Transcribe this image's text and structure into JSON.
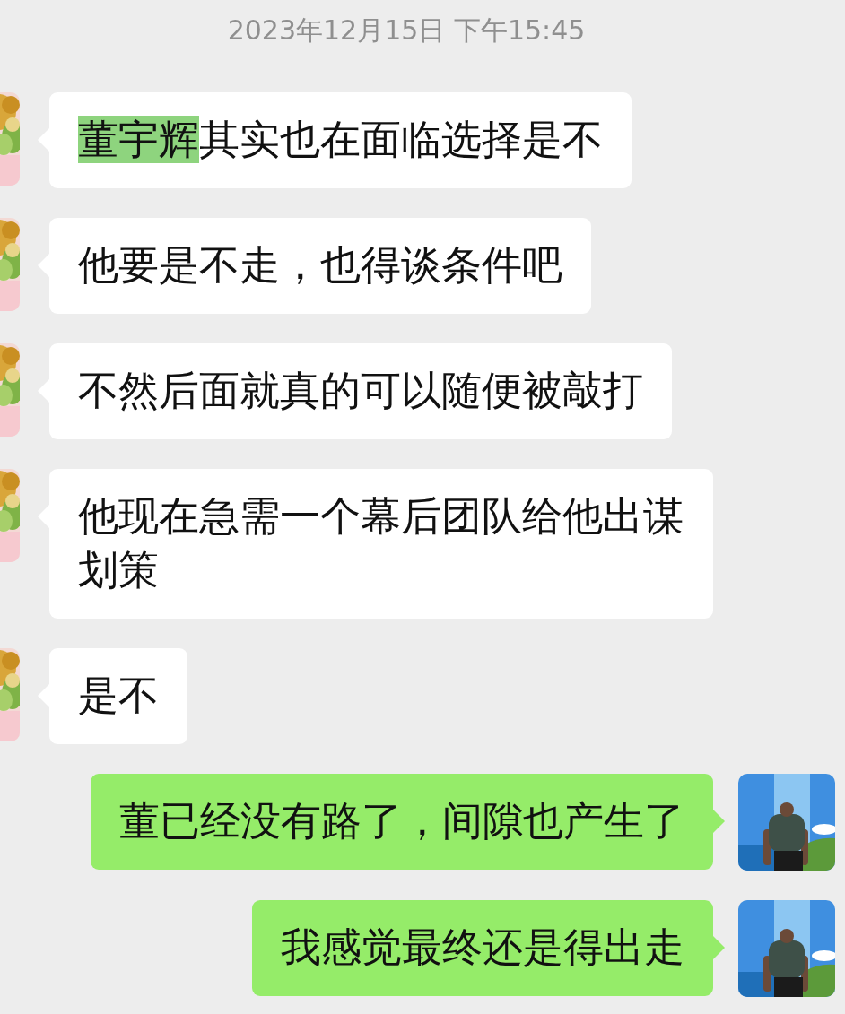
{
  "timestamp": "2023年12月15日 下午15:45",
  "messages": [
    {
      "kind": "incoming",
      "segments": [
        {
          "text": "董宇辉",
          "highlighted": true
        },
        {
          "text": "其实也在面临选择是不",
          "highlighted": false
        }
      ]
    },
    {
      "kind": "incoming",
      "segments": [
        {
          "text": "他要是不走，也得谈条件吧",
          "highlighted": false
        }
      ]
    },
    {
      "kind": "incoming",
      "segments": [
        {
          "text": "不然后面就真的可以随便被敲打",
          "highlighted": false
        }
      ]
    },
    {
      "kind": "incoming",
      "segments": [
        {
          "text": "他现在急需一个幕后团队给他出谋划策",
          "highlighted": false
        }
      ]
    },
    {
      "kind": "incoming",
      "segments": [
        {
          "text": "是不",
          "highlighted": false
        }
      ]
    },
    {
      "kind": "outgoing",
      "segments": [
        {
          "text": "董已经没有路了，间隙也产生了",
          "highlighted": false
        }
      ]
    },
    {
      "kind": "outgoing",
      "segments": [
        {
          "text": "我感觉最终还是得出走",
          "highlighted": false
        }
      ]
    }
  ]
}
